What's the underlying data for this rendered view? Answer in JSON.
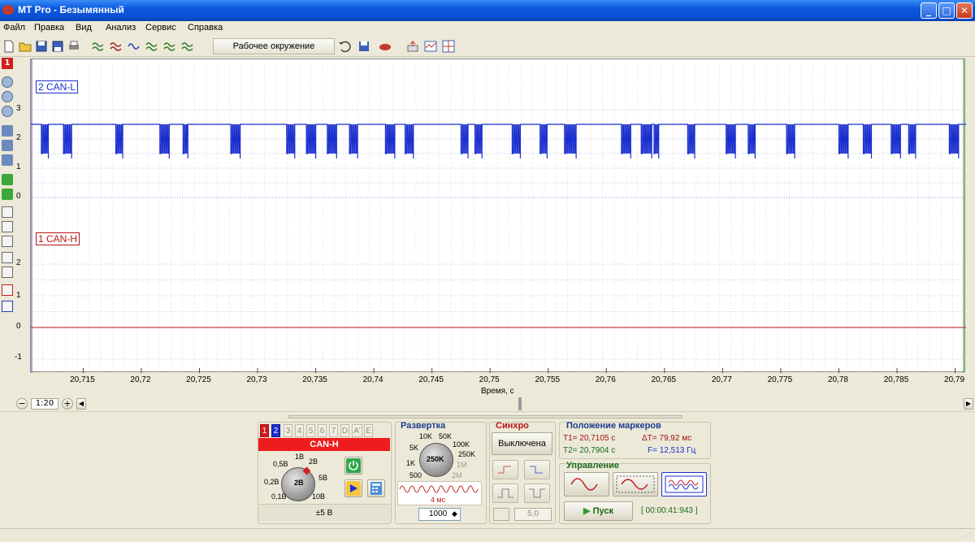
{
  "window": {
    "title": "MT Pro - Безымянный",
    "minimize": "_",
    "maximize": "□",
    "close": "✕"
  },
  "menu": [
    "Файл",
    "Правка",
    "Вид",
    "Анализ",
    "Сервис",
    "Справка"
  ],
  "toolbar": {
    "environment_label": "Рабочее окружение"
  },
  "channels": [
    {
      "label": "2 CAN-L",
      "color": "#1a2fcf",
      "y_ticks": [
        "3",
        "2",
        "1",
        "0"
      ]
    },
    {
      "label": "1 CAN-H",
      "color": "#b81414",
      "y_ticks": [
        "2",
        "1",
        "0",
        "-1"
      ]
    }
  ],
  "chart_data": {
    "type": "line",
    "xlabel": "Время, с",
    "x_ticks": [
      "20,715",
      "20,72",
      "20,725",
      "20,73",
      "20,735",
      "20,74",
      "20,745",
      "20,75",
      "20,755",
      "20,76",
      "20,765",
      "20,77",
      "20,775",
      "20,78",
      "20,785",
      "20,79"
    ],
    "xlim": [
      20.7105,
      20.7908
    ],
    "series": [
      {
        "name": "2 CAN-L",
        "idle_level": 2.5,
        "dominant_level": 1.5,
        "frames": [
          [
            20.7114,
            20.712
          ],
          [
            20.7133,
            20.714
          ],
          [
            20.7178,
            20.7184
          ],
          [
            20.7216,
            20.7224
          ],
          [
            20.7236,
            20.724
          ],
          [
            20.7277,
            20.7285
          ],
          [
            20.7325,
            20.7332
          ],
          [
            20.7342,
            20.735
          ],
          [
            20.736,
            20.7368
          ],
          [
            20.7379,
            20.7386
          ],
          [
            20.741,
            20.7418
          ],
          [
            20.7427,
            20.7434
          ],
          [
            20.7475,
            20.7481
          ],
          [
            20.7487,
            20.7493
          ],
          [
            20.7519,
            20.7526
          ],
          [
            20.7543,
            20.7549
          ],
          [
            20.7564,
            20.7574
          ],
          [
            20.7613,
            20.7621
          ],
          [
            20.763,
            20.7639
          ],
          [
            20.7641,
            20.7645
          ],
          [
            20.767,
            20.7676
          ],
          [
            20.7703,
            20.7711
          ],
          [
            20.7722,
            20.7728
          ],
          [
            20.7755,
            20.7762
          ],
          [
            20.78,
            20.7808
          ],
          [
            20.7821,
            20.7828
          ],
          [
            20.7845,
            20.7853
          ],
          [
            20.786,
            20.7866
          ],
          [
            20.7895,
            20.7903
          ]
        ]
      },
      {
        "name": "1 CAN-H",
        "constant": 0.0
      }
    ]
  },
  "zoom": {
    "label": "1:20"
  },
  "channel_panel": {
    "tabs": [
      "1",
      "2",
      "3",
      "4",
      "5",
      "6",
      "7",
      "D",
      "A'",
      "E"
    ],
    "active_tab": "2",
    "channel_name": "CAN-H",
    "knob_value": "2В",
    "scale_labels": [
      "1В",
      "2В",
      "0,5В",
      "5В",
      "0,2В",
      "0,1В",
      "10В"
    ],
    "range": "±5 В"
  },
  "sweep": {
    "title": "Развертка",
    "knob_value": "250K",
    "scale_labels": [
      "10K",
      "50K",
      "5K",
      "100K",
      "250K",
      "1K",
      "1M",
      "500",
      "2M"
    ],
    "period": "4 мс",
    "points": "1000"
  },
  "sync": {
    "title": "Синхро",
    "mode": "Выключена",
    "level": "5,0"
  },
  "markers": {
    "title": "Положение маркеров",
    "t1": "T1= 20,7105 с",
    "t2": "T2= 20,7904 с",
    "dt": "ΔT= 79,92 мс",
    "freq": "F= 12,513 Гц"
  },
  "control": {
    "title": "Управление",
    "start": "Пуск",
    "time": "[ 00:00:41:943 ]"
  }
}
